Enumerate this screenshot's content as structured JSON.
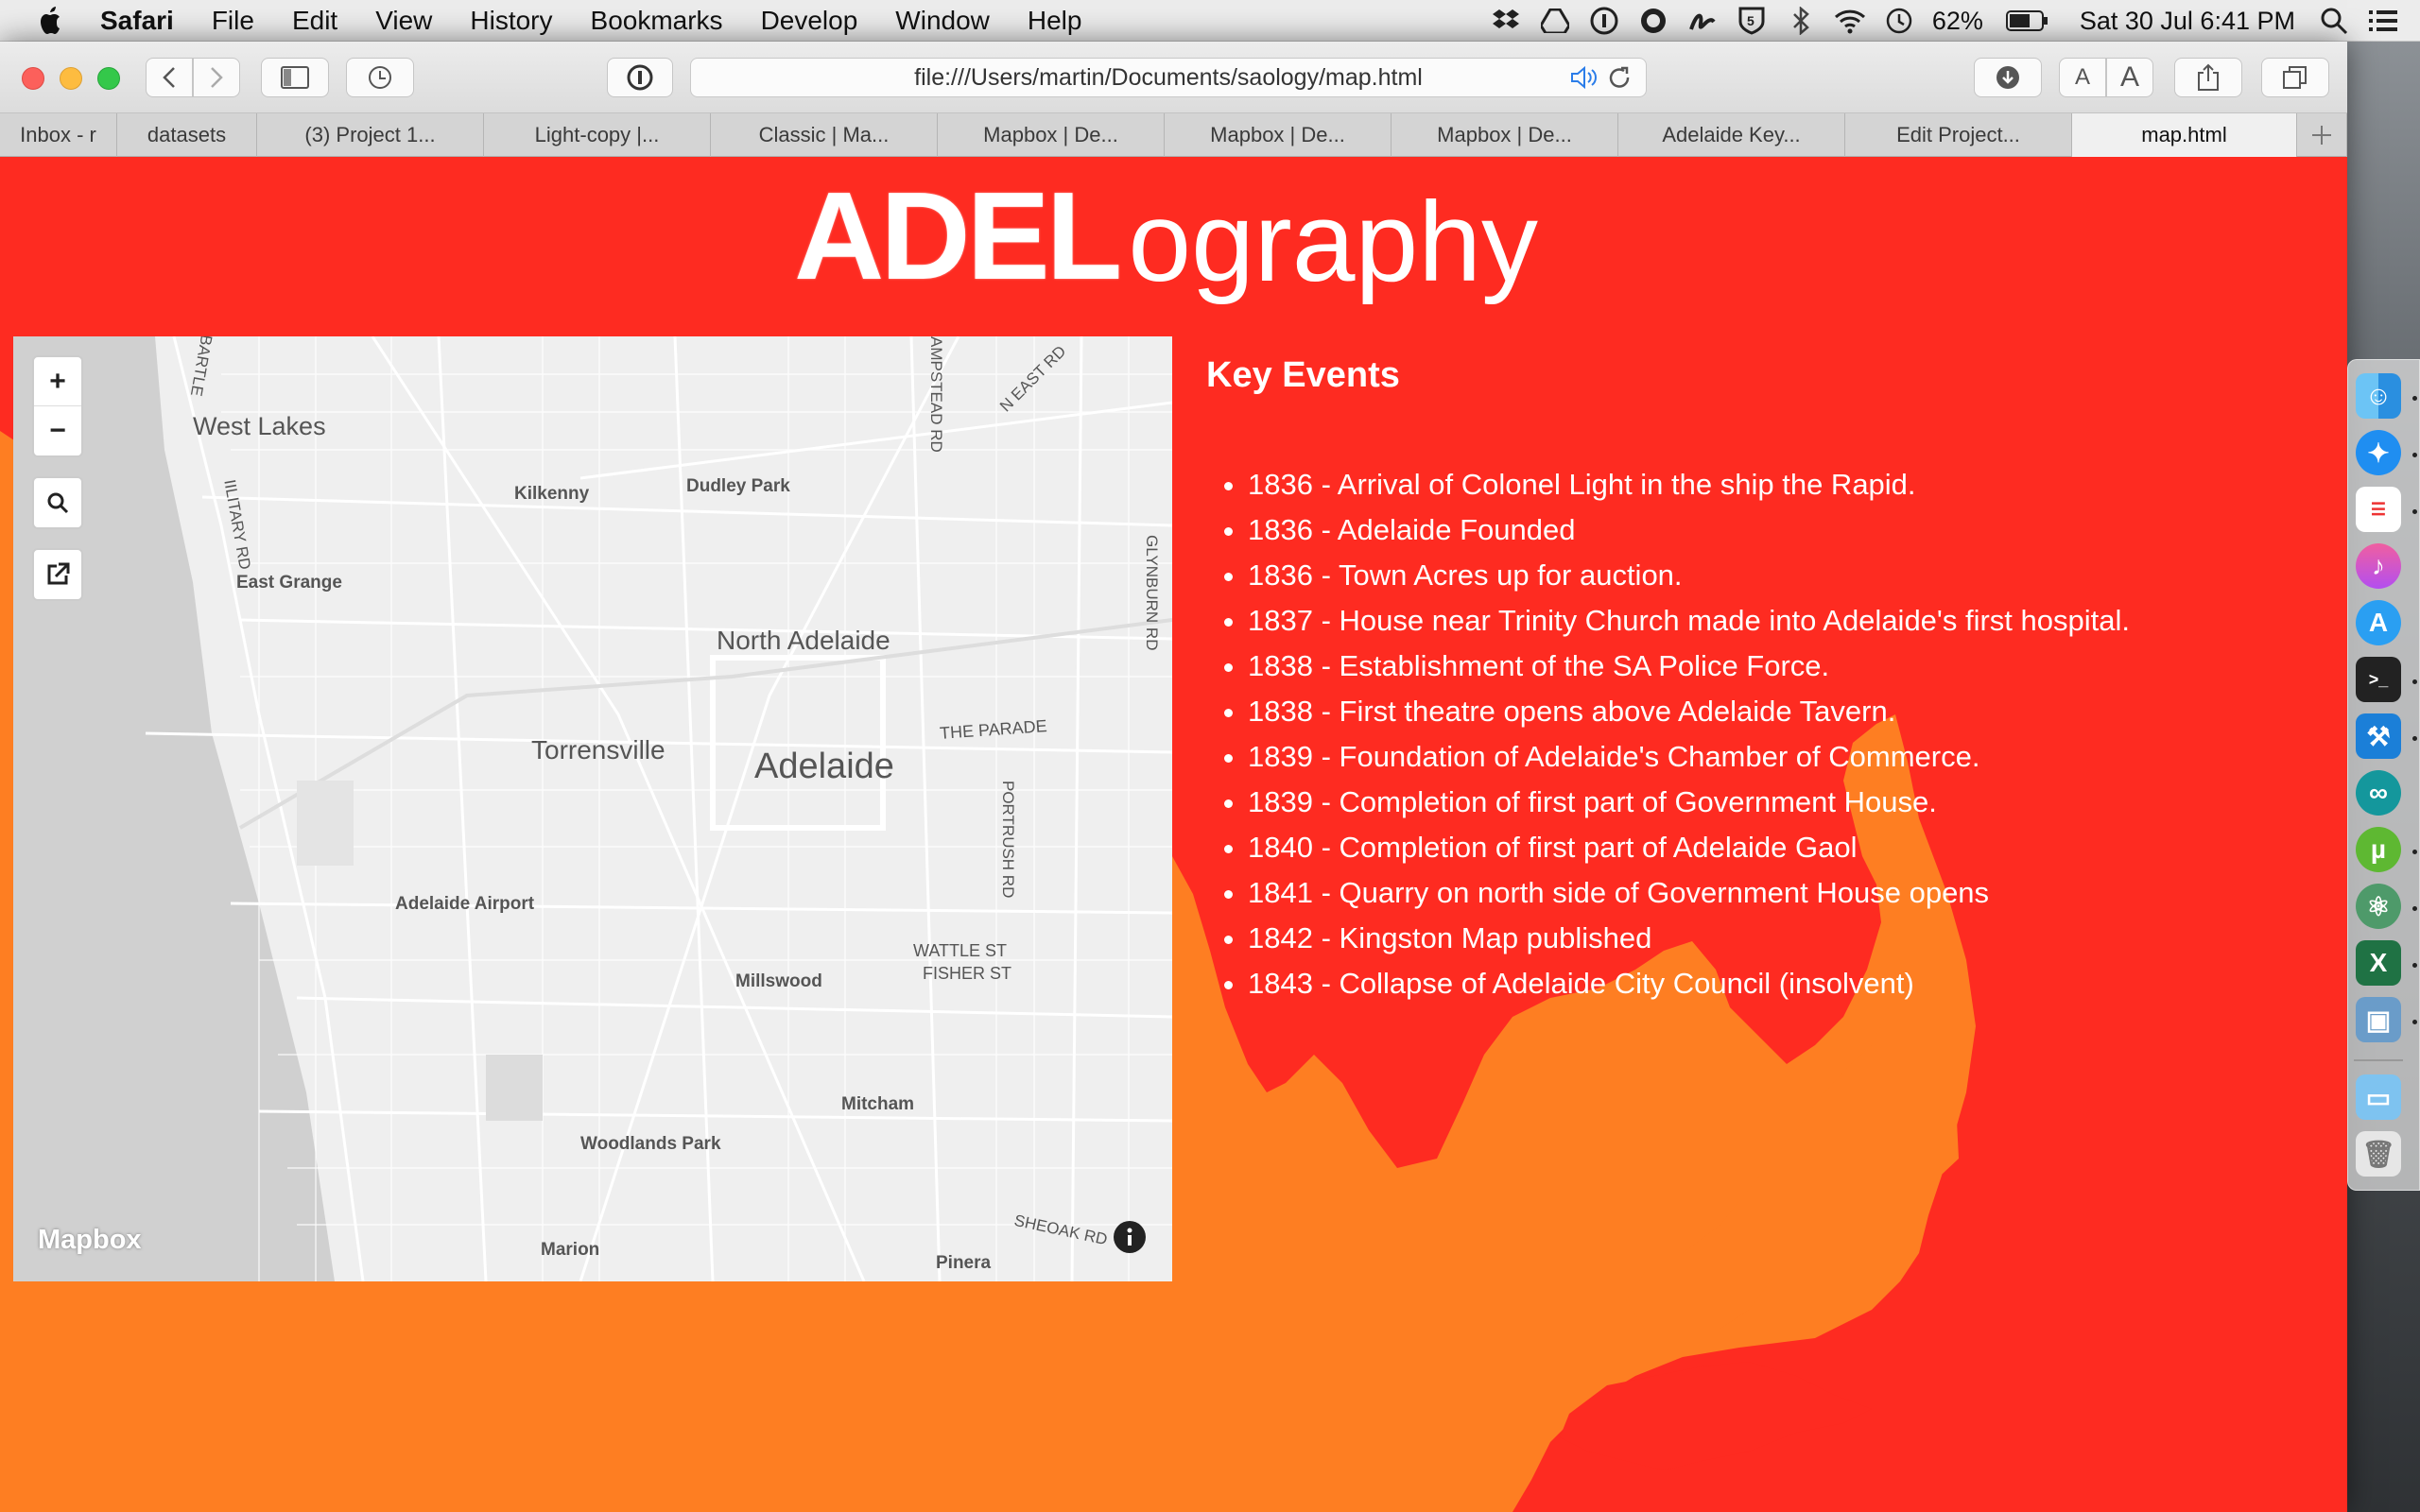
{
  "menubar": {
    "app_name": "Safari",
    "menus": [
      "File",
      "Edit",
      "View",
      "History",
      "Bookmarks",
      "Develop",
      "Window",
      "Help"
    ],
    "battery": "62%",
    "datetime": "Sat 30 Jul  6:41 PM"
  },
  "browser": {
    "address": "file:///Users/martin/Documents/saology/map.html",
    "tabs": [
      {
        "label": "Inbox - r"
      },
      {
        "label": "datasets"
      },
      {
        "label": "(3) Project 1..."
      },
      {
        "label": "Light-copy |..."
      },
      {
        "label": "Classic | Ma..."
      },
      {
        "label": "Mapbox | De..."
      },
      {
        "label": "Mapbox | De..."
      },
      {
        "label": "Mapbox | De..."
      },
      {
        "label": "Adelaide Key..."
      },
      {
        "label": "Edit Project..."
      },
      {
        "label": "map.html"
      }
    ]
  },
  "page": {
    "logo_part1": "ADEL",
    "logo_part2": "ography",
    "key_events_title": "Key Events",
    "events": [
      "1836 - Arrival of Colonel Light in the ship the Rapid.",
      "1836 - Adelaide Founded",
      "1836 - Town Acres up for auction.",
      "1837 - House near Trinity Church made into Adelaide's first hospital.",
      "1838 - Establishment of the SA Police Force.",
      "1838 - First theatre opens above Adelaide Tavern.",
      "1839 - Foundation of Adelaide's Chamber of Commerce.",
      "1839 - Completion of first part of Government House.",
      "1840 - Completion of first part of Adelaide Gaol",
      "1841 - Quarry on north side of Government House opens",
      "1842 - Kingston Map published",
      "1843 - Collapse of Adelaide City Council (insolvent)"
    ],
    "colors": {
      "background": "#fe2b21",
      "land": "#fe7e22"
    }
  },
  "map": {
    "zoom_in": "+",
    "zoom_out": "−",
    "attribution": "Mapbox",
    "labels": {
      "west_lakes": "West Lakes",
      "kilkenny": "Kilkenny",
      "dudley_park": "Dudley Park",
      "east_grange": "East Grange",
      "north_adelaide": "North Adelaide",
      "torrensville": "Torrensville",
      "adelaide": "Adelaide",
      "the_parade": "THE PARADE",
      "portrush_rd": "PORTRUSH RD",
      "glynburn_rd": "GLYNBURN RD",
      "hampstead_rd": "AMPSTEAD RD",
      "n_east_rd": "N EAST RD",
      "military_rd": "IILITARY RD",
      "bartley": "BARTLE",
      "adelaide_airport": "Adelaide Airport",
      "wattle_st": "WATTLE ST",
      "fisher_st": "FISHER ST",
      "millswood": "Millswood",
      "mitcham": "Mitcham",
      "woodlands_park": "Woodlands Park",
      "marion": "Marion",
      "pinera": "Pinera",
      "sheoak_rd": "SHEOAK RD"
    }
  }
}
